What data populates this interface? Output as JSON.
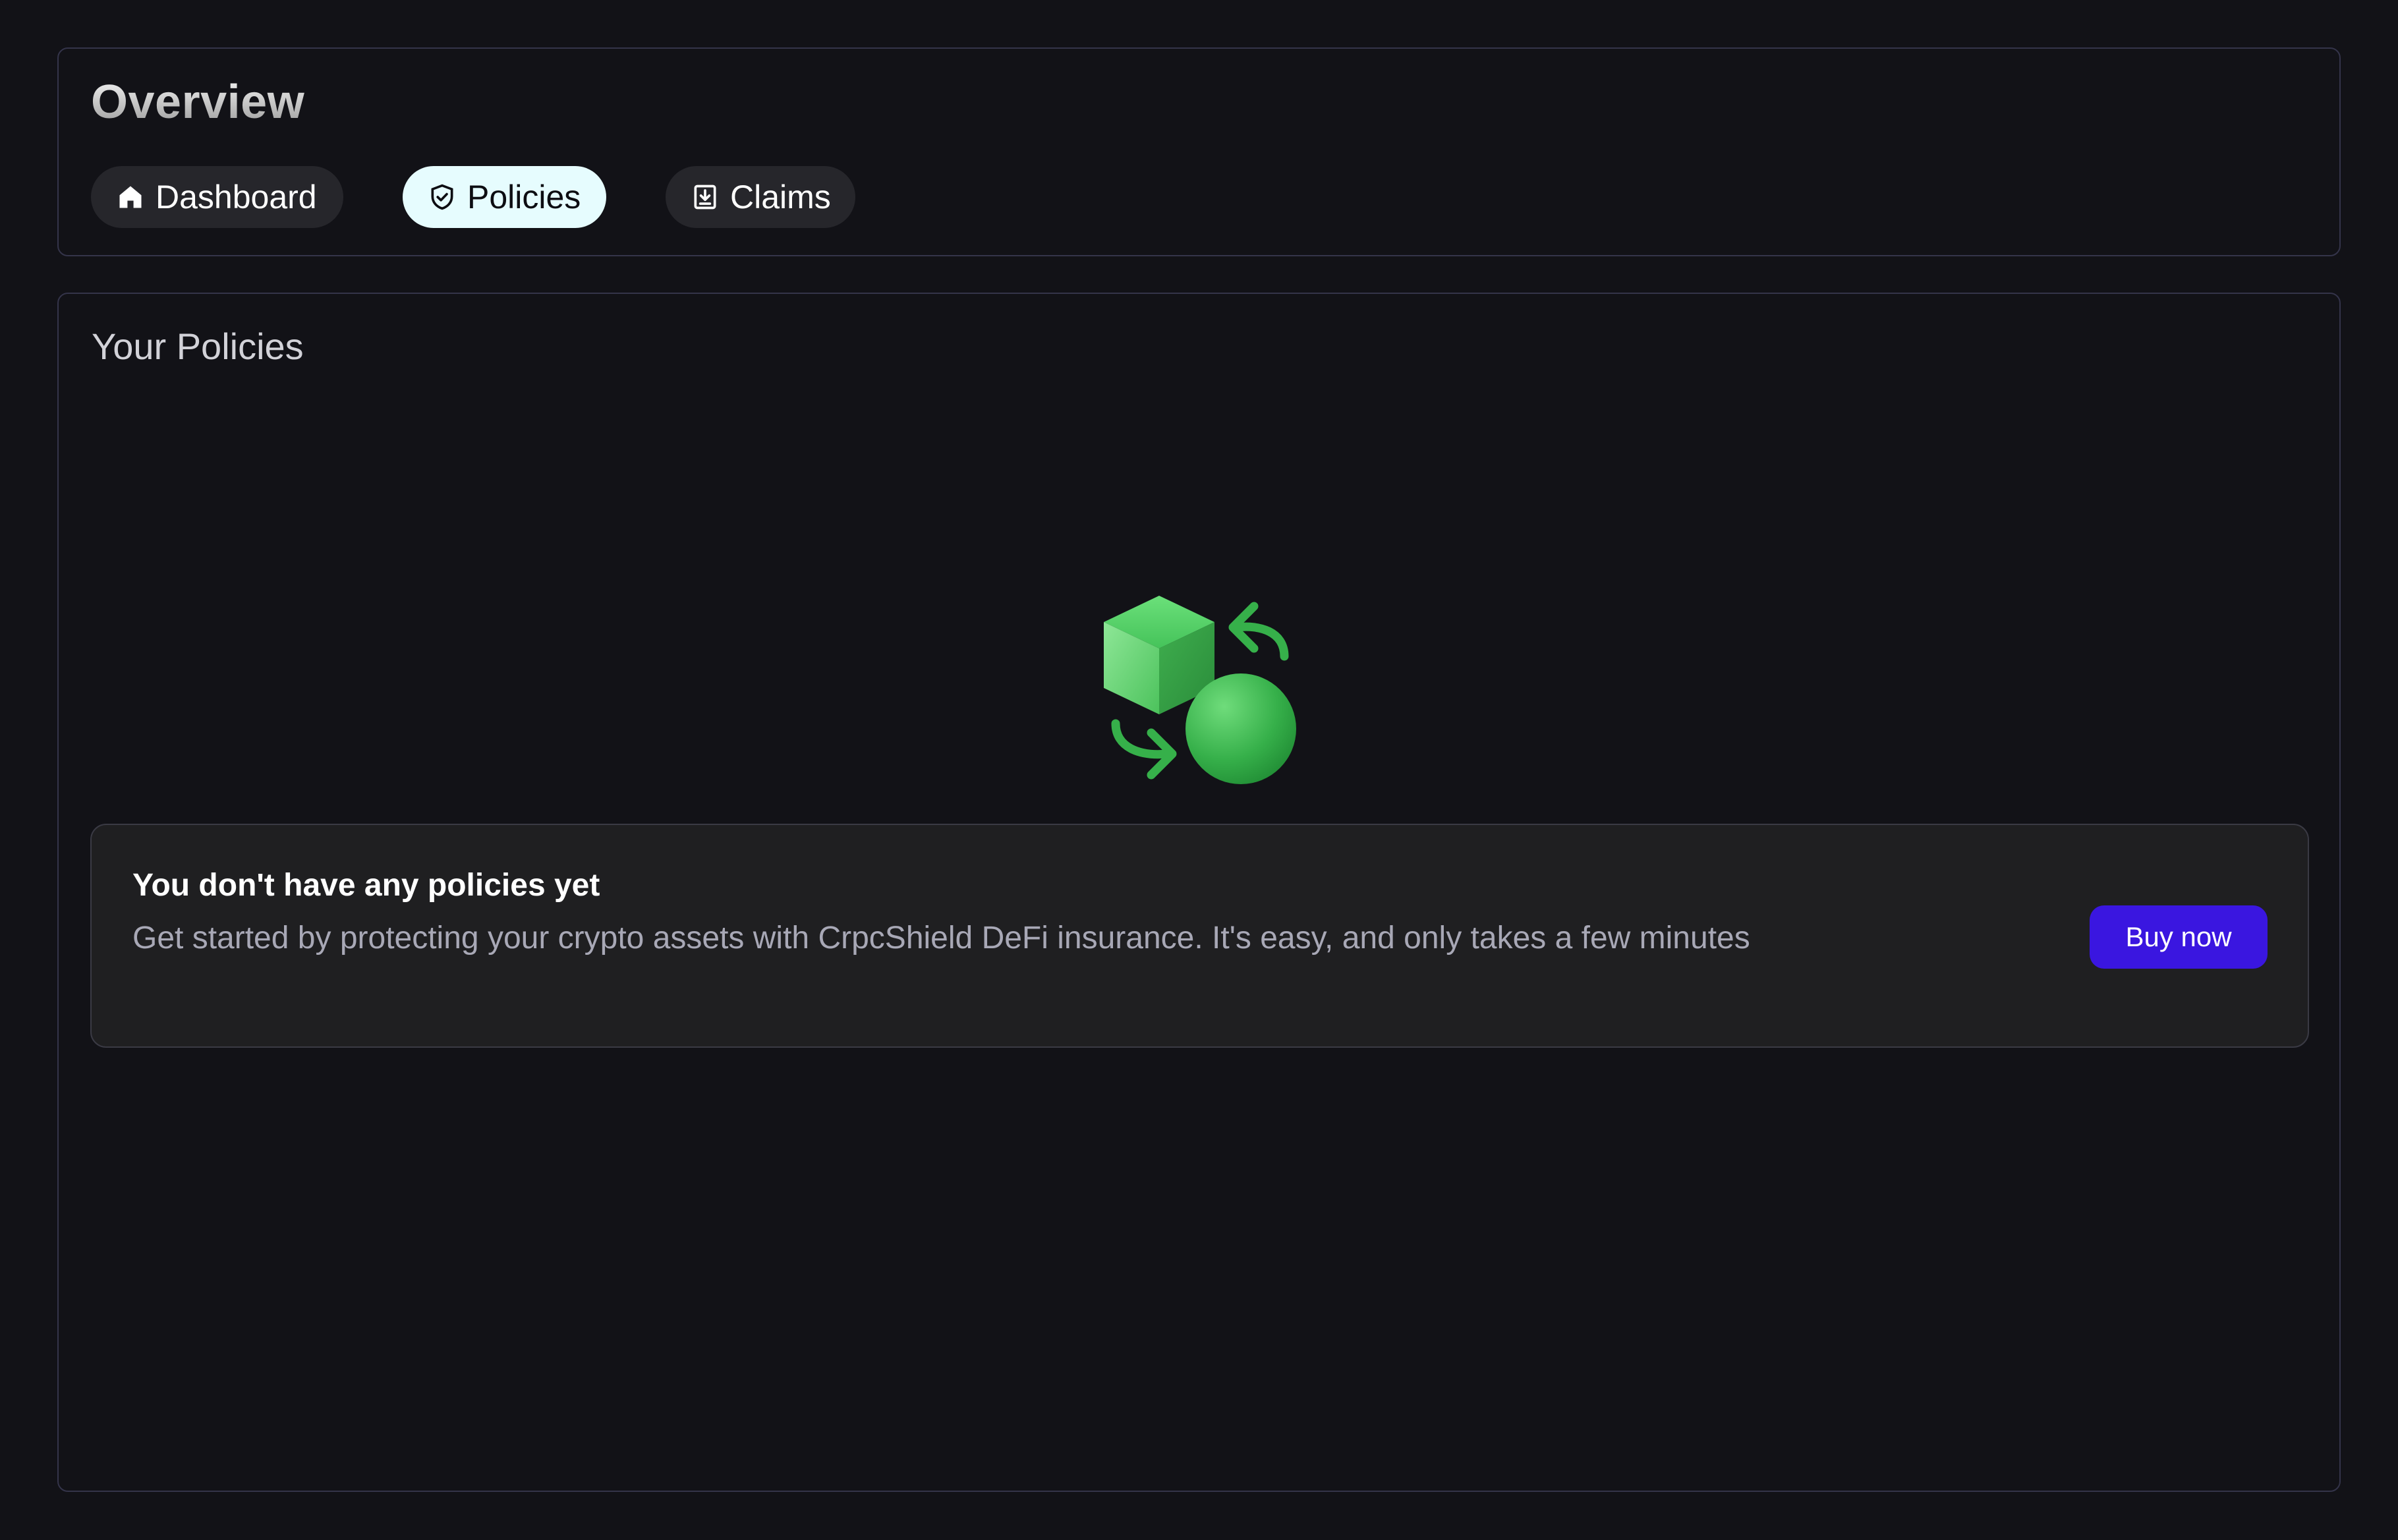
{
  "header": {
    "title": "Overview",
    "tabs": [
      {
        "label": "Dashboard",
        "icon": "home-icon",
        "active": false
      },
      {
        "label": "Policies",
        "icon": "shield-check-icon",
        "active": true
      },
      {
        "label": "Claims",
        "icon": "download-tray-icon",
        "active": false
      }
    ]
  },
  "policies": {
    "title": "Your Policies",
    "empty_state": {
      "illustration": "cube-sphere-exchange-icon",
      "heading": "You don't have any policies yet",
      "text": "Get started by protecting your crypto assets with CrpcShield DeFi insurance. It's easy, and only takes a few minutes",
      "button_label": "Buy now"
    }
  },
  "colors": {
    "background": "#121217",
    "active_tab": "#e6fcfe",
    "inactive_tab": "#26262b",
    "accent_button": "#3a16e0",
    "illustration_green": "#3fb950"
  }
}
